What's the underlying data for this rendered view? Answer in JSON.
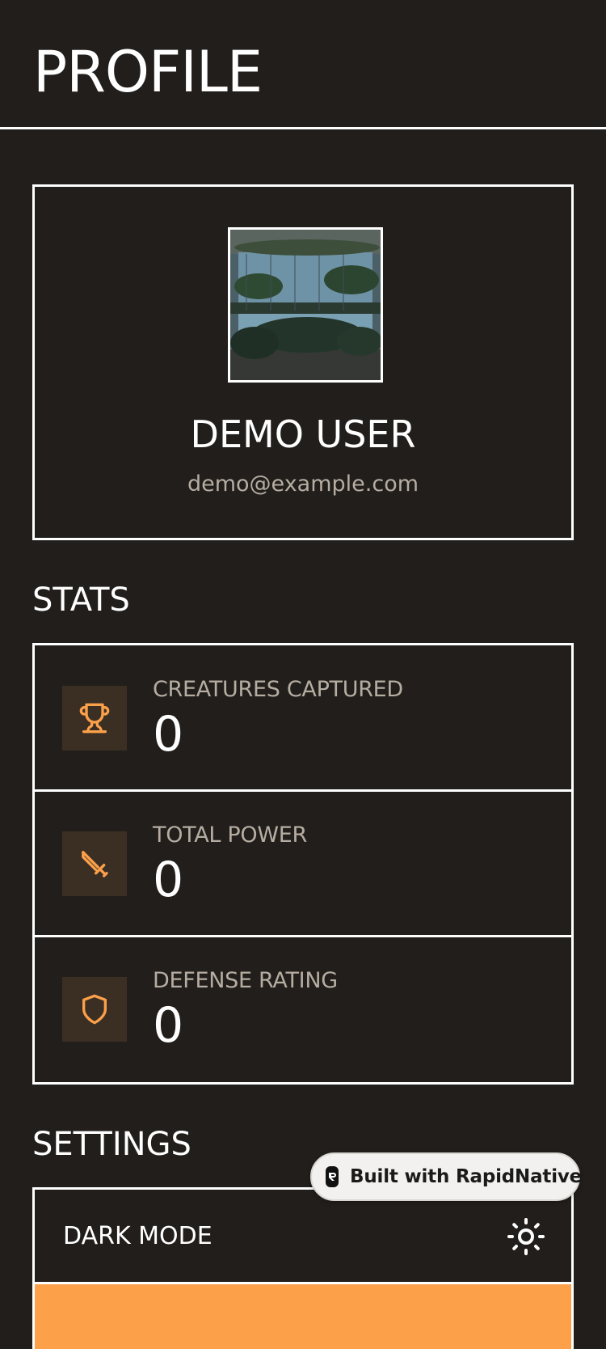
{
  "header": {
    "title": "PROFILE"
  },
  "profile": {
    "avatar_icon": "profile-photo",
    "name": "DEMO USER",
    "email": "demo@example.com"
  },
  "stats": {
    "title": "STATS",
    "items": [
      {
        "icon": "trophy-icon",
        "label": "CREATURES CAPTURED",
        "value": "0"
      },
      {
        "icon": "sword-icon",
        "label": "TOTAL POWER",
        "value": "0"
      },
      {
        "icon": "shield-icon",
        "label": "DEFENSE RATING",
        "value": "0"
      }
    ]
  },
  "settings": {
    "title": "SETTINGS",
    "items": [
      {
        "label": "DARK MODE",
        "icon": "sun-icon"
      }
    ]
  },
  "badge": {
    "text": "Built with RapidNative"
  },
  "colors": {
    "background": "#221e1b",
    "accent": "#fca04a",
    "icon_tile": "#3b2f24",
    "muted_text": "#b5ada2"
  }
}
